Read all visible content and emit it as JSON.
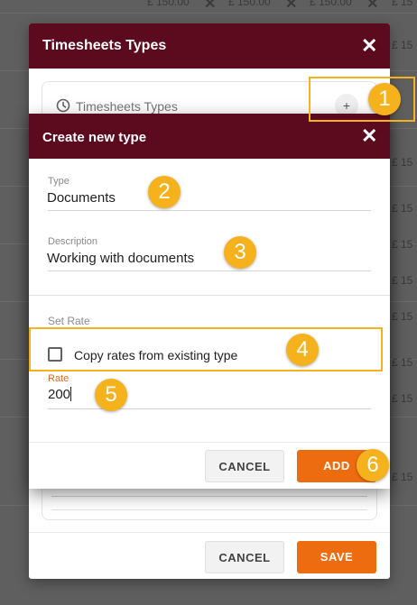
{
  "background": {
    "price": "£ 150.00",
    "price_short": "£ 15",
    "close_glyph": "✕"
  },
  "outer_modal": {
    "title": "Timesheets Types",
    "close_glyph": "✕",
    "section_label": "Timesheets Types",
    "add_glyph": "+",
    "footer": {
      "cancel_label": "CANCEL",
      "save_label": "SAVE"
    }
  },
  "inner_modal": {
    "title": "Create new type",
    "close_glyph": "✕",
    "type_field": {
      "label": "Type",
      "value": "Documents"
    },
    "description_field": {
      "label": "Description",
      "value": "Working with documents"
    },
    "set_rate_title": "Set Rate",
    "copy_rates": {
      "label": "Copy rates from existing type",
      "checked": false
    },
    "rate_field": {
      "label": "Rate",
      "value": "200"
    },
    "footer": {
      "cancel_label": "CANCEL",
      "add_label": "ADD"
    }
  },
  "annotations": {
    "steps": [
      "1",
      "2",
      "3",
      "4",
      "5",
      "6"
    ],
    "highlight_color": "#f5b21c"
  },
  "colors": {
    "header_bg": "#5c0a1e",
    "primary_button": "#ee6c10",
    "overlay": "#5f5f5f"
  }
}
